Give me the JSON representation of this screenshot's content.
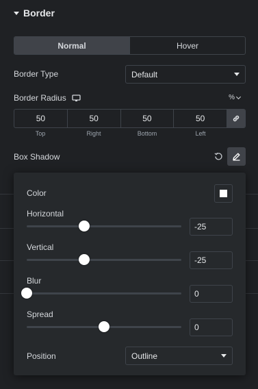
{
  "section": {
    "title": "Border"
  },
  "tabs": [
    {
      "label": "Normal",
      "active": true
    },
    {
      "label": "Hover",
      "active": false
    }
  ],
  "border_type": {
    "label": "Border Type",
    "value": "Default"
  },
  "border_radius": {
    "label": "Border Radius",
    "unit": "%",
    "values": [
      "50",
      "50",
      "50",
      "50"
    ],
    "labels": [
      "Top",
      "Right",
      "Bottom",
      "Left"
    ]
  },
  "box_shadow": {
    "label": "Box Shadow",
    "color_label": "Color",
    "color": "#ffffff",
    "controls": [
      {
        "label": "Horizontal",
        "value": "-25",
        "fraction": 0.37
      },
      {
        "label": "Vertical",
        "value": "-25",
        "fraction": 0.37
      },
      {
        "label": "Blur",
        "value": "0",
        "fraction": 0.0
      },
      {
        "label": "Spread",
        "value": "0",
        "fraction": 0.5
      }
    ],
    "position_label": "Position",
    "position_value": "Outline"
  },
  "colors": {
    "background": "#1f2124",
    "panel": "#26292c",
    "active_tab": "#404349"
  },
  "icons": [
    "caret-down-icon",
    "desktop-icon",
    "link-icon",
    "reset-icon",
    "pencil-icon",
    "dropdown-arrow-icon"
  ]
}
